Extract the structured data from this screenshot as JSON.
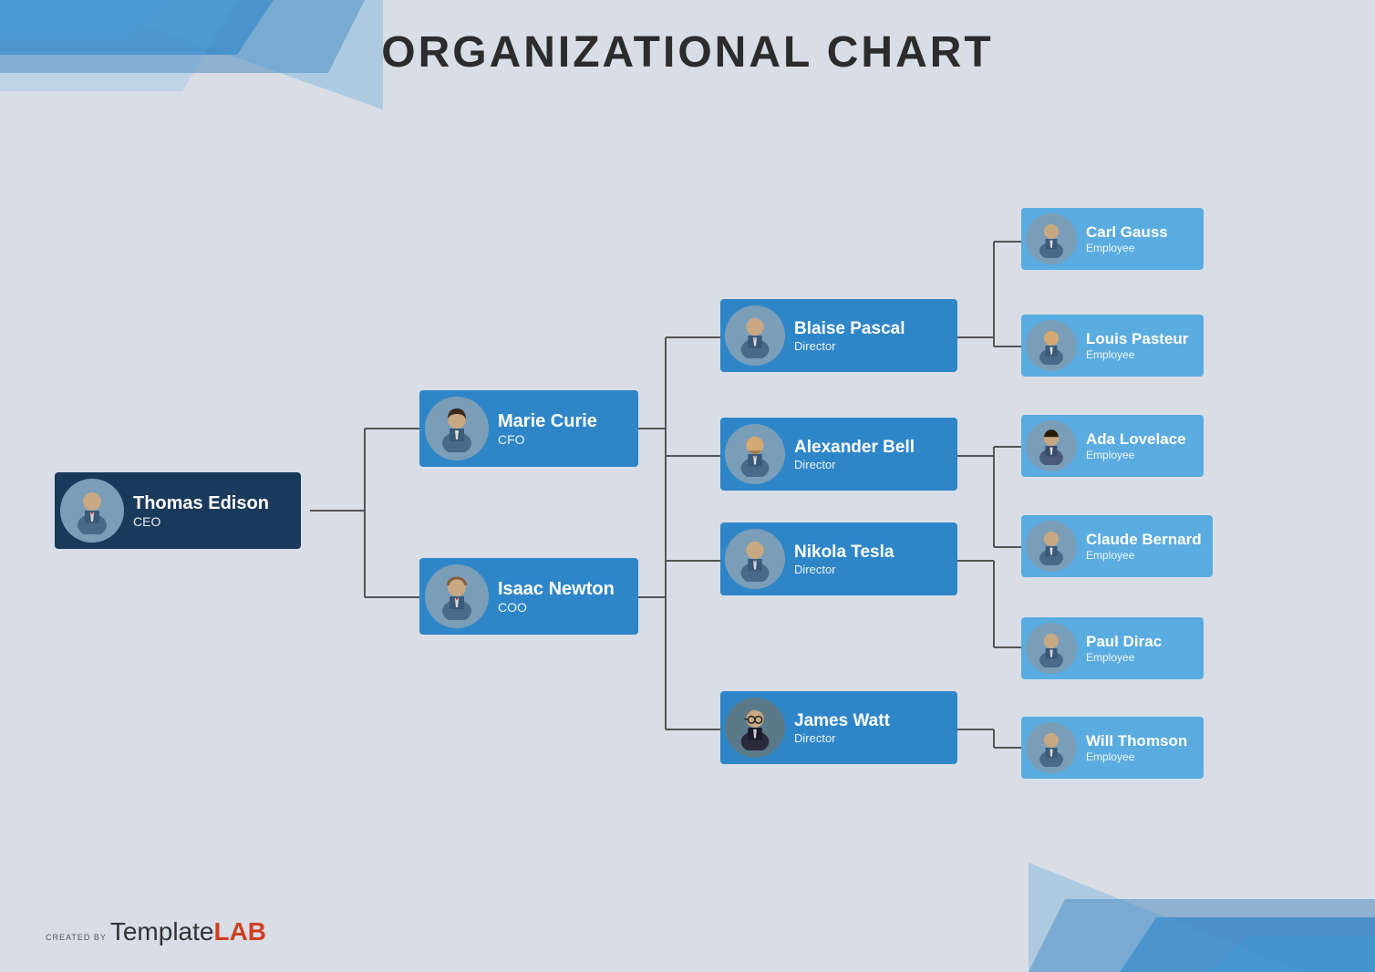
{
  "title": "ORGANIZATIONAL CHART",
  "colors": {
    "dark_card": "#1a3a5c",
    "blue_card": "#2e86c8",
    "light_blue_card": "#5aace0",
    "avatar_bg": "#8aacbf",
    "line": "#555555",
    "bg": "#d8dde6"
  },
  "people": {
    "ceo": {
      "name": "Thomas Edison",
      "role": "CEO"
    },
    "cfo": {
      "name": "Marie Curie",
      "role": "CFO"
    },
    "coo": {
      "name": "Isaac Newton",
      "role": "COO"
    },
    "directors": [
      {
        "name": "Blaise Pascal",
        "role": "Director"
      },
      {
        "name": "Alexander Bell",
        "role": "Director"
      },
      {
        "name": "Nikola Tesla",
        "role": "Director"
      },
      {
        "name": "James Watt",
        "role": "Director"
      }
    ],
    "employees": [
      {
        "name": "Carl Gauss",
        "role": "Employee"
      },
      {
        "name": "Louis Pasteur",
        "role": "Employee"
      },
      {
        "name": "Ada Lovelace",
        "role": "Employee"
      },
      {
        "name": "Claude Bernard",
        "role": "Employee"
      },
      {
        "name": "Paul Dirac",
        "role": "Employee"
      },
      {
        "name": "Will Thomson",
        "role": "Employee"
      }
    ]
  },
  "footer": {
    "created_by": "CREATED BY",
    "template_text": "Template",
    "lab_text": "LAB"
  }
}
